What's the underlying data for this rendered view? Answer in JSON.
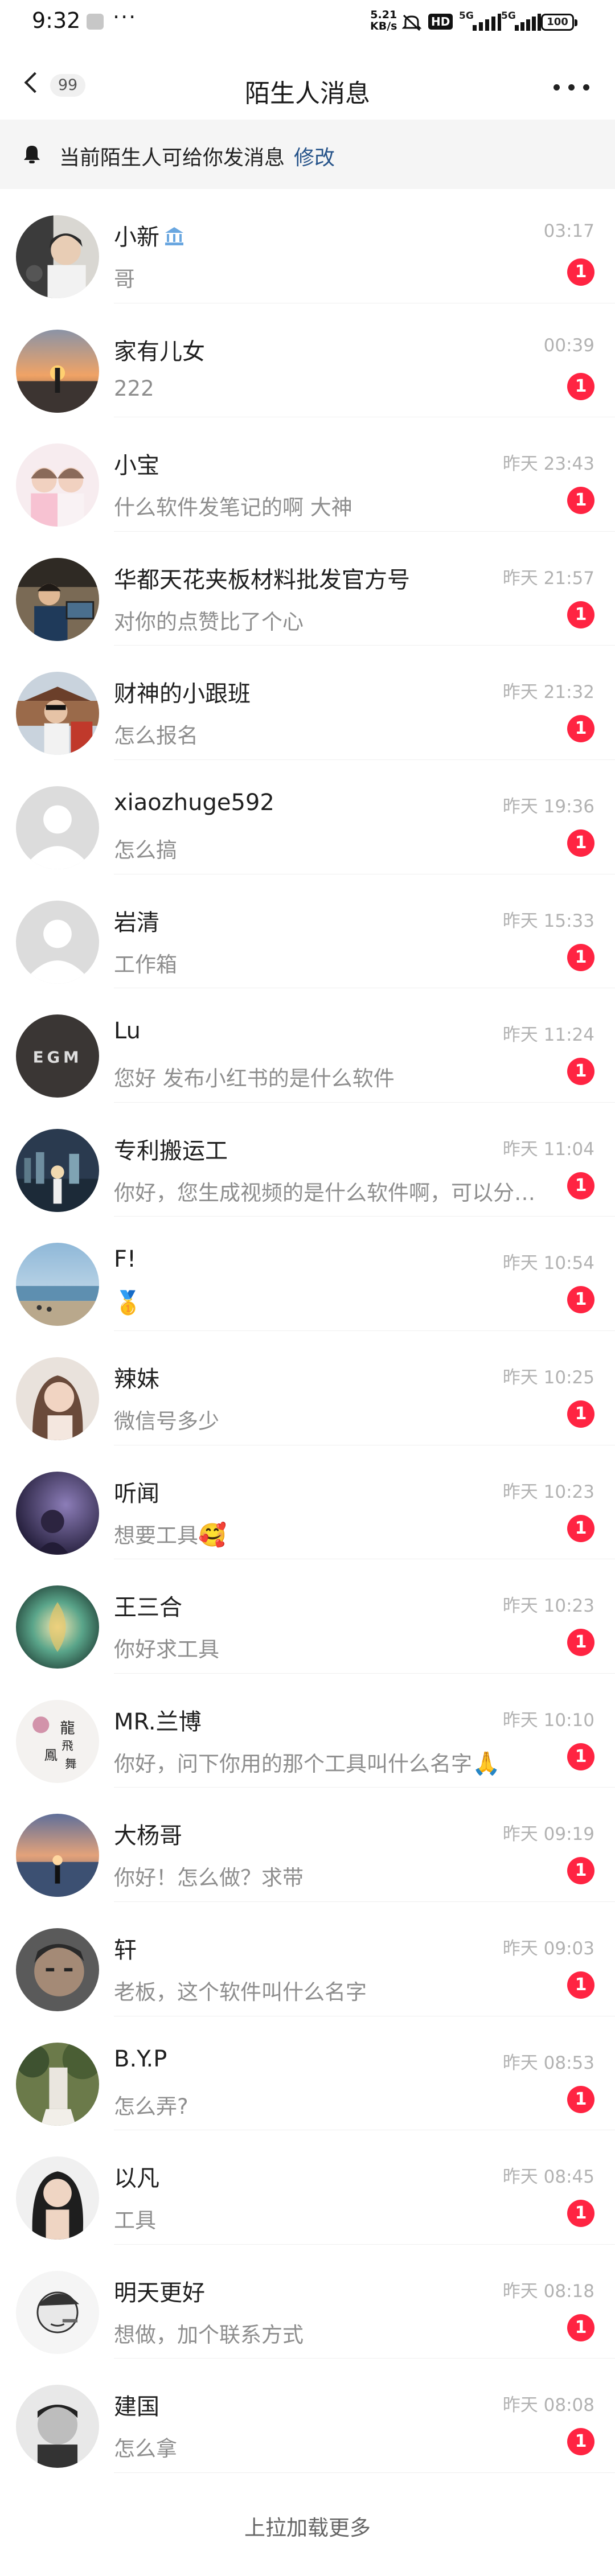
{
  "status_bar": {
    "time": "9:32",
    "more": "···",
    "speed_value": "5.21",
    "speed_unit": "KB/s",
    "hd": "HD",
    "signal_1": "5G",
    "signal_2": "5G",
    "battery": "100"
  },
  "header": {
    "back_count": "99",
    "title": "陌生人消息"
  },
  "notice": {
    "text": "当前陌生人可给你发消息",
    "link": "修改"
  },
  "messages": [
    {
      "name": "小新",
      "time": "03:17",
      "preview": "哥",
      "unread": "1",
      "avatar": "portrait-dark"
    },
    {
      "name": "家有儿女",
      "time": "00:39",
      "preview": "222",
      "unread": "1",
      "avatar": "sunset"
    },
    {
      "name": "小宝",
      "time": "昨天 23:43",
      "preview": "什么软件发笔记的啊 大神",
      "unread": "1",
      "avatar": "kids"
    },
    {
      "name": "华都天花夹板材料批发官方号",
      "time": "昨天 21:57",
      "preview": "对你的点赞比了个心",
      "unread": "1",
      "avatar": "office"
    },
    {
      "name": "财神的小跟班",
      "time": "昨天 21:32",
      "preview": "怎么报名",
      "unread": "1",
      "avatar": "temple"
    },
    {
      "name": "xiaozhuge592",
      "time": "昨天 19:36",
      "preview": "怎么搞",
      "unread": "1",
      "avatar": "default"
    },
    {
      "name": "岩清",
      "time": "昨天 15:33",
      "preview": "工作箱",
      "unread": "1",
      "avatar": "default"
    },
    {
      "name": "Lu",
      "time": "昨天 11:24",
      "preview": "您好  发布小红书的是什么软件",
      "unread": "1",
      "avatar": "egm",
      "avatar_text": "EGM"
    },
    {
      "name": "专利搬运工",
      "time": "昨天 11:04",
      "preview": "你好，您生成视频的是什么软件啊，可以分享一下吗",
      "unread": "1",
      "avatar": "night-city"
    },
    {
      "name": "F!",
      "time": "昨天 10:54",
      "preview": "",
      "preview_emoji": "🥇",
      "unread": "1",
      "avatar": "beach"
    },
    {
      "name": "辣妹",
      "time": "昨天 10:25",
      "preview": "微信号多少",
      "unread": "1",
      "avatar": "girl"
    },
    {
      "name": "听闻",
      "time": "昨天 10:23",
      "preview": "想要工具",
      "preview_emoji": "🥰",
      "unread": "1",
      "avatar": "dark-purple"
    },
    {
      "name": "王三合",
      "time": "昨天 10:23",
      "preview": "你好求工具",
      "unread": "1",
      "avatar": "jade"
    },
    {
      "name": "MR.兰博",
      "time": "昨天 10:10",
      "preview": "你好，问下你用的那个工具叫什么名字",
      "preview_emoji": "🙏",
      "unread": "1",
      "avatar": "calligraphy",
      "avatar_text": "龍飛鳳舞"
    },
    {
      "name": "大杨哥",
      "time": "昨天 09:19",
      "preview": "你好！怎么做？求带",
      "unread": "1",
      "avatar": "sea-sunset"
    },
    {
      "name": "轩",
      "time": "昨天 09:03",
      "preview": "老板，这个软件叫什么名字",
      "unread": "1",
      "avatar": "man-face"
    },
    {
      "name": "B.Y.P",
      "time": "昨天 08:53",
      "preview": "怎么弄?",
      "unread": "1",
      "avatar": "forest"
    },
    {
      "name": "以凡",
      "time": "昨天 08:45",
      "preview": "工具",
      "unread": "1",
      "avatar": "woman-hair"
    },
    {
      "name": "明天更好",
      "time": "昨天 08:18",
      "preview": "想做，加个联系方式",
      "unread": "1",
      "avatar": "sketch"
    },
    {
      "name": "建国",
      "time": "昨天 08:08",
      "preview": "怎么拿",
      "unread": "1",
      "avatar": "bw-boy"
    }
  ],
  "footer": {
    "load_more": "上拉加载更多"
  }
}
